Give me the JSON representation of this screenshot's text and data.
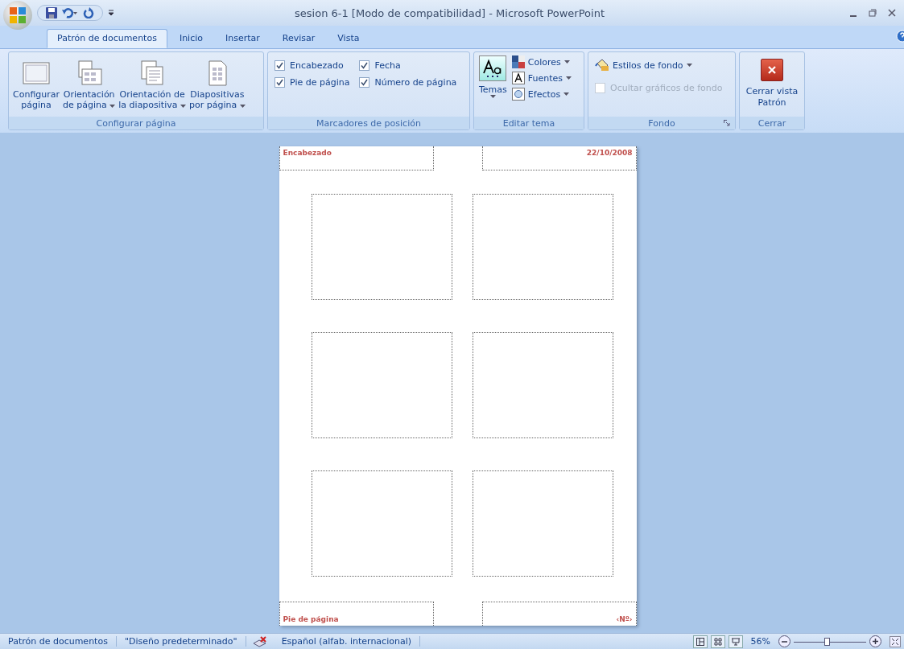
{
  "window": {
    "title": "sesion 6-1 [Modo de compatibilidad] - Microsoft PowerPoint"
  },
  "tabs": [
    {
      "label": "Patrón de documentos",
      "selected": true
    },
    {
      "label": "Inicio",
      "selected": false
    },
    {
      "label": "Insertar",
      "selected": false
    },
    {
      "label": "Revisar",
      "selected": false
    },
    {
      "label": "Vista",
      "selected": false
    }
  ],
  "ribbon": {
    "configurar": {
      "label": "Configurar página",
      "buttons": [
        {
          "kind": "config",
          "lines": [
            "Configurar",
            "página"
          ],
          "dropdown": false
        },
        {
          "kind": "orient-page",
          "lines": [
            "Orientación",
            "de página"
          ],
          "dropdown": true
        },
        {
          "kind": "orient-slide",
          "lines": [
            "Orientación de",
            "la diapositiva"
          ],
          "dropdown": true
        },
        {
          "kind": "per-page",
          "lines": [
            "Diapositivas",
            "por página"
          ],
          "dropdown": true
        }
      ]
    },
    "marcadores": {
      "label": "Marcadores de posición",
      "checks": [
        {
          "label": "Encabezado",
          "checked": true
        },
        {
          "label": "Fecha",
          "checked": true
        },
        {
          "label": "Pie de página",
          "checked": true
        },
        {
          "label": "Número de página",
          "checked": true
        }
      ]
    },
    "tema": {
      "label": "Editar tema",
      "temas": "Temas",
      "items": [
        {
          "kind": "colors",
          "label": "Colores"
        },
        {
          "kind": "fonts",
          "label": "Fuentes"
        },
        {
          "kind": "effects",
          "label": "Efectos"
        }
      ]
    },
    "fondo": {
      "label": "Fondo",
      "styles": "Estilos de fondo",
      "hide": {
        "label": "Ocultar gráficos de fondo",
        "checked": false,
        "disabled": true
      }
    },
    "cerrar": {
      "label": "Cerrar",
      "button": [
        "Cerrar vista",
        "Patrón"
      ]
    }
  },
  "page": {
    "header": "Encabezado",
    "date": "22/10/2008",
    "footer": "Pie de página",
    "number": "‹Nº›"
  },
  "status_bar": {
    "items": [
      "Patrón de documentos",
      "\"Diseño predeterminado\"",
      "Español (alfab. internacional)"
    ],
    "zoom": "56%",
    "zoom_slider": {
      "level": 0.45
    }
  }
}
